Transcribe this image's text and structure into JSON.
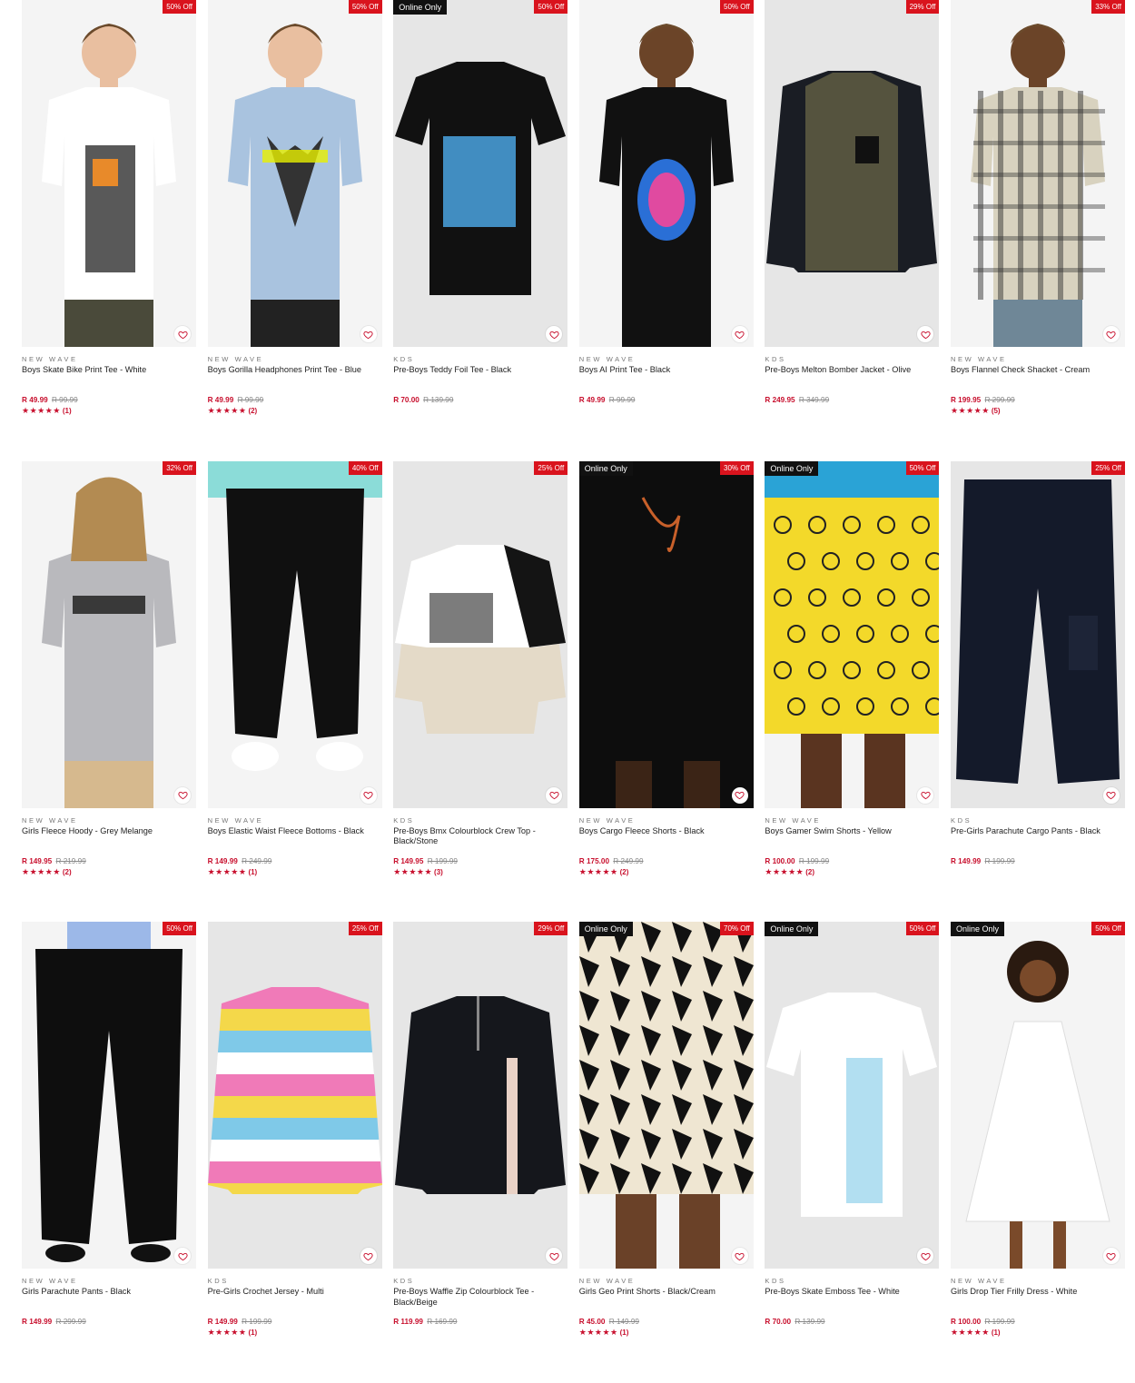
{
  "products": [
    {
      "brand": "NEW WAVE",
      "name": "Boys Skate Bike Print Tee - White",
      "price": "R 49.99",
      "was": "R 99.99",
      "discount": "50% Off",
      "online_only": false,
      "rating_count": "(1)",
      "image": "white-tee-model",
      "bg": "#f4f4f4"
    },
    {
      "brand": "NEW WAVE",
      "name": "Boys Gorilla Headphones Print Tee - Blue",
      "price": "R 49.99",
      "was": "R 99.99",
      "discount": "50% Off",
      "online_only": false,
      "rating_count": "(2)",
      "image": "blue-tee-model",
      "bg": "#f4f4f4"
    },
    {
      "brand": "KDS",
      "name": "Pre-Boys Teddy Foil Tee - Black",
      "price": "R 70.00",
      "was": "R 139.99",
      "discount": "50% Off",
      "online_only": true,
      "online_label": "Online Only",
      "rating_count": "",
      "image": "black-tee-flat",
      "bg": "#e6e6e6"
    },
    {
      "brand": "NEW WAVE",
      "name": "Boys AI Print Tee - Black",
      "price": "R 49.99",
      "was": "R 99.99",
      "discount": "50% Off",
      "online_only": false,
      "rating_count": "",
      "image": "black-tee-model",
      "bg": "#f4f4f4"
    },
    {
      "brand": "KDS",
      "name": "Pre-Boys Melton Bomber Jacket - Olive",
      "price": "R 249.95",
      "was": "R 349.99",
      "discount": "29% Off",
      "online_only": false,
      "rating_count": "",
      "image": "olive-jacket",
      "bg": "#e6e6e6"
    },
    {
      "brand": "NEW WAVE",
      "name": "Boys Flannel Check Shacket - Cream",
      "price": "R 199.95",
      "was": "R 299.99",
      "discount": "33% Off",
      "online_only": false,
      "rating_count": "(5)",
      "image": "flannel-model",
      "bg": "#f4f4f4"
    },
    {
      "brand": "NEW WAVE",
      "name": "Girls Fleece Hoody - Grey Melange",
      "price": "R 149.95",
      "was": "R 219.99",
      "discount": "32% Off",
      "online_only": false,
      "rating_count": "(2)",
      "image": "grey-hoody-model",
      "bg": "#f4f4f4"
    },
    {
      "brand": "NEW WAVE",
      "name": "Boys Elastic Waist Fleece Bottoms - Black",
      "price": "R 149.99",
      "was": "R 249.99",
      "discount": "40% Off",
      "online_only": false,
      "rating_count": "(1)",
      "image": "black-bottoms-model",
      "bg": "#f4f4f4"
    },
    {
      "brand": "KDS",
      "name": "Pre-Boys Bmx Colourblock Crew Top - Black/Stone",
      "price": "R 149.95",
      "was": "R 199.99",
      "discount": "25% Off",
      "online_only": false,
      "rating_count": "(3)",
      "image": "bmx-top",
      "bg": "#e6e6e6"
    },
    {
      "brand": "NEW WAVE",
      "name": "Boys Cargo Fleece Shorts - Black",
      "price": "R 175.00",
      "was": "R 249.99",
      "discount": "30% Off",
      "online_only": true,
      "online_label": "Online Only",
      "rating_count": "(2)",
      "image": "black-shorts-model",
      "bg": "#f4f4f4"
    },
    {
      "brand": "NEW WAVE",
      "name": "Boys Gamer Swim Shorts - Yellow",
      "price": "R 100.00",
      "was": "R 199.99",
      "discount": "50% Off",
      "online_only": true,
      "online_label": "Online Only",
      "rating_count": "(2)",
      "image": "yellow-shorts-model",
      "bg": "#f4f4f4"
    },
    {
      "brand": "KDS",
      "name": "Pre-Girls Parachute Cargo Pants - Black",
      "price": "R 149.99",
      "was": "R 199.99",
      "discount": "25% Off",
      "online_only": false,
      "rating_count": "",
      "image": "navy-cargo-flat",
      "bg": "#e6e6e6"
    },
    {
      "brand": "NEW WAVE",
      "name": "Girls Parachute Pants - Black",
      "price": "R 149.99",
      "was": "R 299.99",
      "discount": "50% Off",
      "online_only": false,
      "rating_count": "",
      "image": "black-pants-model",
      "bg": "#f4f4f4"
    },
    {
      "brand": "KDS",
      "name": "Pre-Girls Crochet Jersey - Multi",
      "price": "R 149.99",
      "was": "R 199.99",
      "discount": "25% Off",
      "online_only": false,
      "rating_count": "(1)",
      "image": "crochet-jersey",
      "bg": "#e6e6e6"
    },
    {
      "brand": "KDS",
      "name": "Pre-Boys Waffle Zip Colourblock Tee - Black/Beige",
      "price": "R 119.99",
      "was": "R 169.99",
      "discount": "29% Off",
      "online_only": false,
      "rating_count": "",
      "image": "waffle-zip-top",
      "bg": "#e6e6e6"
    },
    {
      "brand": "NEW WAVE",
      "name": "Girls Geo Print Shorts - Black/Cream",
      "price": "R 45.00",
      "was": "R 149.99",
      "discount": "70% Off",
      "online_only": true,
      "online_label": "Online Only",
      "rating_count": "(1)",
      "image": "geo-shorts-model",
      "bg": "#f4f4f4"
    },
    {
      "brand": "KDS",
      "name": "Pre-Boys Skate Emboss Tee - White",
      "price": "R 70.00",
      "was": "R 139.99",
      "discount": "50% Off",
      "online_only": true,
      "online_label": "Online Only",
      "rating_count": "",
      "image": "white-tee-flat",
      "bg": "#e6e6e6"
    },
    {
      "brand": "NEW WAVE",
      "name": "Girls Drop Tier Frilly Dress - White",
      "price": "R 100.00",
      "was": "R 199.99",
      "discount": "50% Off",
      "online_only": true,
      "online_label": "Online Only",
      "rating_count": "(1)",
      "image": "white-dress-model",
      "bg": "#f4f4f4"
    }
  ],
  "stars": "★★★★★",
  "colors": {
    "sale_red": "#c8102e",
    "badge_red": "#d9131d",
    "online_badge": "#111111"
  }
}
